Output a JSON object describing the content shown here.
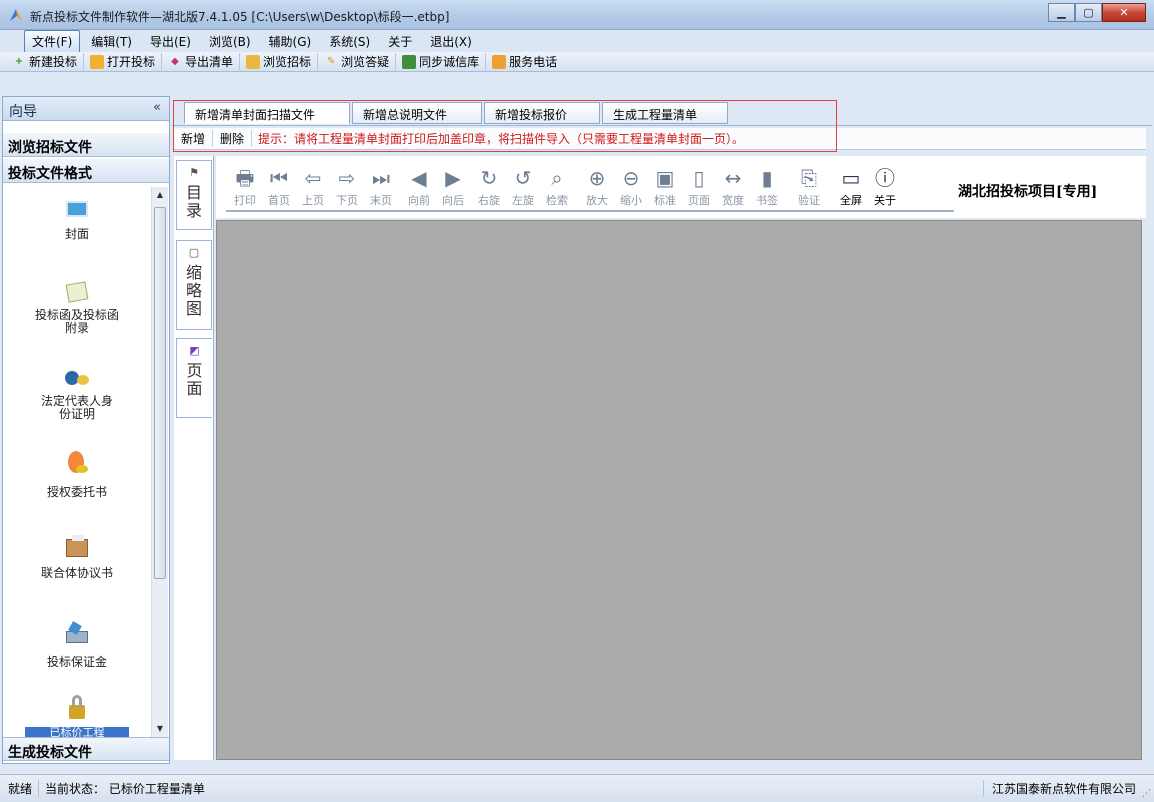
{
  "window": {
    "title": "新点投标文件制作软件—湖北版7.4.1.05    [C:\\Users\\w\\Desktop\\标段一.etbp]"
  },
  "menu": [
    {
      "label": "文件(F)",
      "active": true
    },
    {
      "label": "编辑(T)"
    },
    {
      "label": "导出(E)"
    },
    {
      "label": "浏览(B)"
    },
    {
      "label": "辅助(G)"
    },
    {
      "label": "系统(S)"
    },
    {
      "label": "关于"
    },
    {
      "label": "退出(X)"
    }
  ],
  "toolbar": {
    "items": [
      {
        "label": "新建投标",
        "icon": "new-bid-icon"
      },
      {
        "label": "打开投标",
        "icon": "open-folder-icon"
      },
      {
        "label": "导出清单",
        "icon": "export-icon"
      },
      {
        "label": "浏览招标",
        "icon": "browse-icon"
      },
      {
        "label": "浏览答疑",
        "icon": "qa-icon"
      },
      {
        "label": "同步诚信库",
        "icon": "sync-icon"
      },
      {
        "label": "服务电话",
        "icon": "phone-icon"
      }
    ]
  },
  "sidebar": {
    "header": "向导",
    "collapse": "«",
    "section_browse": "浏览招标文件",
    "section_format": "投标文件格式",
    "section_generate": "生成投标文件",
    "items": [
      {
        "label": "封面",
        "icon": "cover-icon"
      },
      {
        "label": "投标函及投标函附录",
        "icon": "bid-letter-icon"
      },
      {
        "label": "法定代表人身份证明",
        "icon": "legal-rep-icon"
      },
      {
        "label": "授权委托书",
        "icon": "authorization-icon"
      },
      {
        "label": "联合体协议书",
        "icon": "consortium-icon"
      },
      {
        "label": "投标保证金",
        "icon": "deposit-icon"
      },
      {
        "label": "已标价工程",
        "icon": "priced-project-icon"
      }
    ]
  },
  "tabs": [
    {
      "label": "新增清单封面扫描文件",
      "active": true
    },
    {
      "label": "新增总说明文件"
    },
    {
      "label": "新增投标报价"
    },
    {
      "label": "生成工程量清单"
    }
  ],
  "actions": {
    "add": "新增",
    "delete": "删除",
    "hint": "提示：请将工程量清单封面打印后加盖印章，将扫描件导入（只需要工程量清单封面一页）。"
  },
  "side_tabs": [
    {
      "label": "目录",
      "icon": "bookmark-icon"
    },
    {
      "label": "缩略图",
      "icon": "thumbnail-icon"
    },
    {
      "label": "页面",
      "icon": "page-icon"
    }
  ],
  "viewer_toolbar": [
    {
      "label": "打印",
      "icon": "print-icon",
      "glyph": "🖶"
    },
    {
      "label": "首页",
      "icon": "first-page-icon",
      "glyph": "⏮"
    },
    {
      "label": "上页",
      "icon": "prev-page-icon",
      "glyph": "⇦"
    },
    {
      "label": "下页",
      "icon": "next-page-icon",
      "glyph": "⇨"
    },
    {
      "label": "末页",
      "icon": "last-page-icon",
      "glyph": "⏭"
    },
    {
      "label": "向前",
      "icon": "back-icon",
      "glyph": "◀"
    },
    {
      "label": "向后",
      "icon": "forward-icon",
      "glyph": "▶"
    },
    {
      "label": "右旋",
      "icon": "rotate-right-icon",
      "glyph": "↻"
    },
    {
      "label": "左旋",
      "icon": "rotate-left-icon",
      "glyph": "↺"
    },
    {
      "label": "检索",
      "icon": "binoculars-icon",
      "glyph": "⌕"
    },
    {
      "label": "放大",
      "icon": "zoom-in-icon",
      "glyph": "⊕"
    },
    {
      "label": "缩小",
      "icon": "zoom-out-icon",
      "glyph": "⊖"
    },
    {
      "label": "标准",
      "icon": "actual-size-icon",
      "glyph": "▣"
    },
    {
      "label": "页面",
      "icon": "fit-page-icon",
      "glyph": "▯"
    },
    {
      "label": "宽度",
      "icon": "fit-width-icon",
      "glyph": "↔"
    },
    {
      "label": "书签",
      "icon": "bookmark-tool-icon",
      "glyph": "▮"
    },
    {
      "label": "验证",
      "icon": "verify-icon",
      "glyph": "⎘"
    },
    {
      "label": "全屏",
      "icon": "fullscreen-icon",
      "glyph": "▭",
      "dark": true
    },
    {
      "label": "关于",
      "icon": "info-icon",
      "glyph": "ⓘ",
      "dark": true
    }
  ],
  "project_title": "湖北招投标项目[专用]",
  "status": {
    "ready": "就绪",
    "state": "当前状态：  已标价工程量清单",
    "company": "江苏国泰新点软件有限公司"
  },
  "colors": {
    "accent": "#5a7fb5",
    "hint_red": "#d01818",
    "canvas_gray": "#ababab"
  }
}
